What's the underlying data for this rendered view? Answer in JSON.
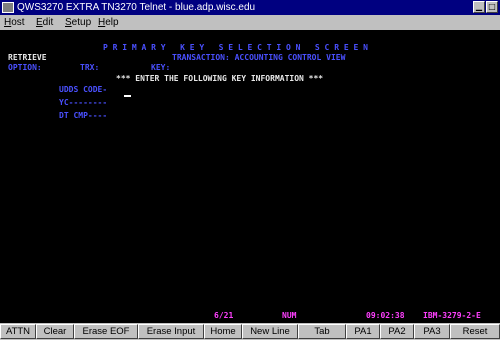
{
  "window": {
    "title": "QWS3270 EXTRA TN3270 Telnet - blue.adp.wisc.edu"
  },
  "menu": [
    {
      "accel": "H",
      "rest": "ost"
    },
    {
      "accel": "E",
      "rest": "dit"
    },
    {
      "accel": "S",
      "rest": "etup"
    },
    {
      "accel": "H",
      "rest": "elp"
    }
  ],
  "screen": {
    "header": "P R I M A R Y   K E Y   S E L E C T I O N   S C R E E N",
    "mode": "RETRIEVE",
    "transaction": "TRANSACTION: ACCOUNTING CONTROL VIEW",
    "option_label": "OPTION:",
    "trx_label": "TRX:",
    "key_label": "KEY:",
    "instruction": "*** ENTER THE FOLLOWING KEY INFORMATION ***",
    "fields": [
      {
        "label": "UDDS CODE-"
      },
      {
        "label": "YC--------"
      },
      {
        "label": "DT CMP----"
      }
    ],
    "status": {
      "position": "6/21",
      "num": "NUM",
      "time": "09:02:38",
      "terminal": "IBM-3279-2-E"
    }
  },
  "fkeys": [
    "ATTN",
    "Clear",
    "Erase EOF",
    "Erase Input",
    "Home",
    "New Line",
    "Tab",
    "PA1",
    "PA2",
    "PA3",
    "Reset"
  ],
  "colors": {
    "screen_bg": "#000000",
    "field_text": "#4a50ff",
    "info_text": "#e8e8e8",
    "status_text": "#ff40ff",
    "titlebar": "#000080"
  }
}
